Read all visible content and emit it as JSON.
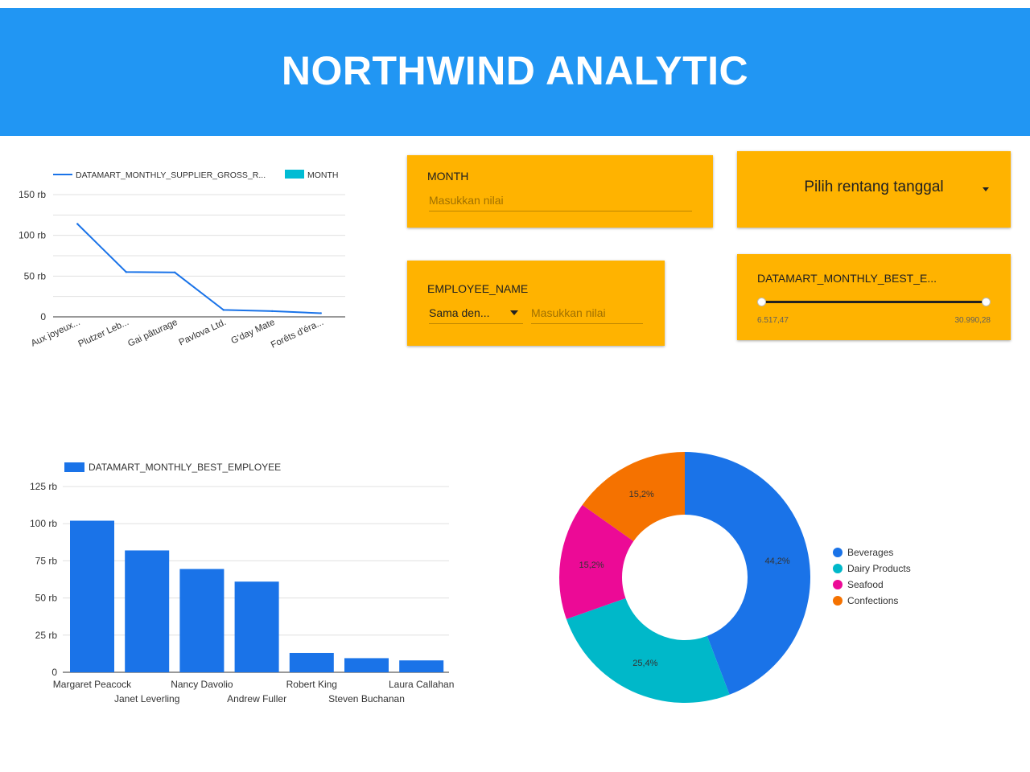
{
  "header": {
    "title": "NORTHWIND ANALYTIC"
  },
  "filters": {
    "month": {
      "label": "MONTH",
      "placeholder": "Masukkan nilai"
    },
    "date_range": {
      "label": "Pilih rentang tanggal"
    },
    "employee_name": {
      "label": "EMPLOYEE_NAME",
      "operator": "Sama den...",
      "placeholder": "Masukkan nilai"
    },
    "best_employee_range": {
      "label": "DATAMART_MONTHLY_BEST_E...",
      "min": "6.517,47",
      "max": "30.990,28",
      "min_fraction": 0,
      "max_fraction": 1
    }
  },
  "colors": {
    "header": "#2196f3",
    "panel": "#ffb300",
    "line": "#1a73e8",
    "bar": "#1a73e8",
    "teal": "#00bcd4",
    "beverages": "#1a73e8",
    "dairy": "#00b8c9",
    "seafood": "#ec0a96",
    "confections": "#f57200"
  },
  "chart_data": [
    {
      "type": "line",
      "legend": [
        "DATAMART_MONTHLY_SUPPLIER_GROSS_R...",
        "MONTH"
      ],
      "categories": [
        "Aux joyeux...",
        "Plutzer Leb...",
        "Gai pâturage",
        "Pavlova Ltd.",
        "G'day Mate",
        "Forêts d'éra..."
      ],
      "values": [
        114000,
        55000,
        54500,
        8500,
        7000,
        4500
      ],
      "ylim": [
        0,
        150000
      ],
      "yticks": [
        {
          "value": 150000,
          "label": "150 rb"
        },
        {
          "value": 100000,
          "label": "100 rb"
        },
        {
          "value": 50000,
          "label": "50 rb"
        },
        {
          "value": 0,
          "label": "0"
        }
      ],
      "grid": true,
      "legend_position": "top"
    },
    {
      "type": "bar",
      "legend": [
        "DATAMART_MONTHLY_BEST_EMPLOYEE"
      ],
      "categories": [
        "Margaret Peacock",
        "Janet Leverling",
        "Nancy Davolio",
        "Andrew Fuller",
        "Robert King",
        "Steven Buchanan",
        "Laura Callahan"
      ],
      "values": [
        102000,
        82000,
        69500,
        61000,
        13000,
        9500,
        8000
      ],
      "ylim": [
        0,
        125000
      ],
      "yticks": [
        {
          "value": 125000,
          "label": "125 rb"
        },
        {
          "value": 100000,
          "label": "100 rb"
        },
        {
          "value": 75000,
          "label": "75 rb"
        },
        {
          "value": 50000,
          "label": "50 rb"
        },
        {
          "value": 25000,
          "label": "25 rb"
        },
        {
          "value": 0,
          "label": "0"
        }
      ],
      "grid": true,
      "legend_position": "top"
    },
    {
      "type": "pie",
      "donut": true,
      "slices": [
        {
          "label": "Beverages",
          "value": 44.2,
          "pct_label": "44,2%",
          "color": "#1a73e8"
        },
        {
          "label": "Dairy Products",
          "value": 25.4,
          "pct_label": "25,4%",
          "color": "#00b8c9"
        },
        {
          "label": "Seafood",
          "value": 15.2,
          "pct_label": "15,2%",
          "color": "#ec0a96"
        },
        {
          "label": "Confections",
          "value": 15.2,
          "pct_label": "15,2%",
          "color": "#f57200"
        }
      ],
      "legend_position": "right"
    }
  ]
}
